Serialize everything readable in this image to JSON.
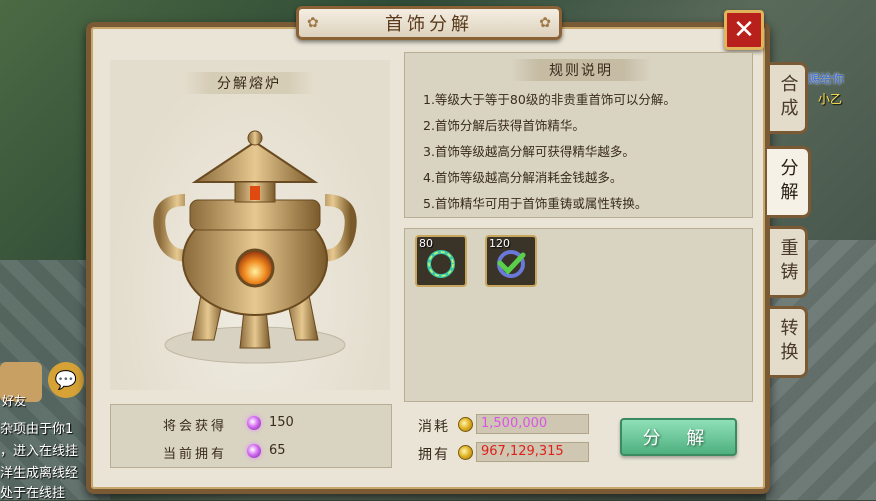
{
  "window": {
    "title": "首饰分解",
    "close_label": "✕"
  },
  "tabs": [
    {
      "label": "合成",
      "active": false
    },
    {
      "label": "分解",
      "active": true
    },
    {
      "label": "重铸",
      "active": false
    },
    {
      "label": "转换",
      "active": false
    }
  ],
  "furnace": {
    "label": "分解熔炉"
  },
  "rules": {
    "title": "规则说明",
    "items": [
      "1.等级大于等于80级的非贵重首饰可以分解。",
      "2.首饰分解后获得首饰精华。",
      "3.首饰等级越高分解可获得精华越多。",
      "4.首饰等级越高分解消耗金钱越多。",
      "5.首饰精华可用于首饰重铸或属性转换。"
    ]
  },
  "items": [
    {
      "level": "80",
      "icon": "bracelet-icon",
      "checked": false
    },
    {
      "level": "120",
      "icon": "bracelet-checked-icon",
      "checked": true
    }
  ],
  "summary": {
    "gain_label": "将会获得",
    "gain_value": "150",
    "own_label": "当前拥有",
    "own_value": "65"
  },
  "cost": {
    "consume_label": "消耗",
    "consume_value": "1,500,000",
    "own_label": "拥有",
    "own_value": "967,129,315"
  },
  "decompose_button": "分 解",
  "background": {
    "chat_lines": [
      "杂项由于你1",
      "，进入在线挂",
      "洋生成离线经",
      "处于在线挂"
    ],
    "friend_label": "好友",
    "npc_name_1": "赐给你",
    "npc_name_2": "小乙",
    "chat_icon": "💬"
  },
  "colors": {
    "accent": "#7a5a34",
    "consume": "#d855e8",
    "own": "#e0201c",
    "button": "#4eb07e"
  }
}
